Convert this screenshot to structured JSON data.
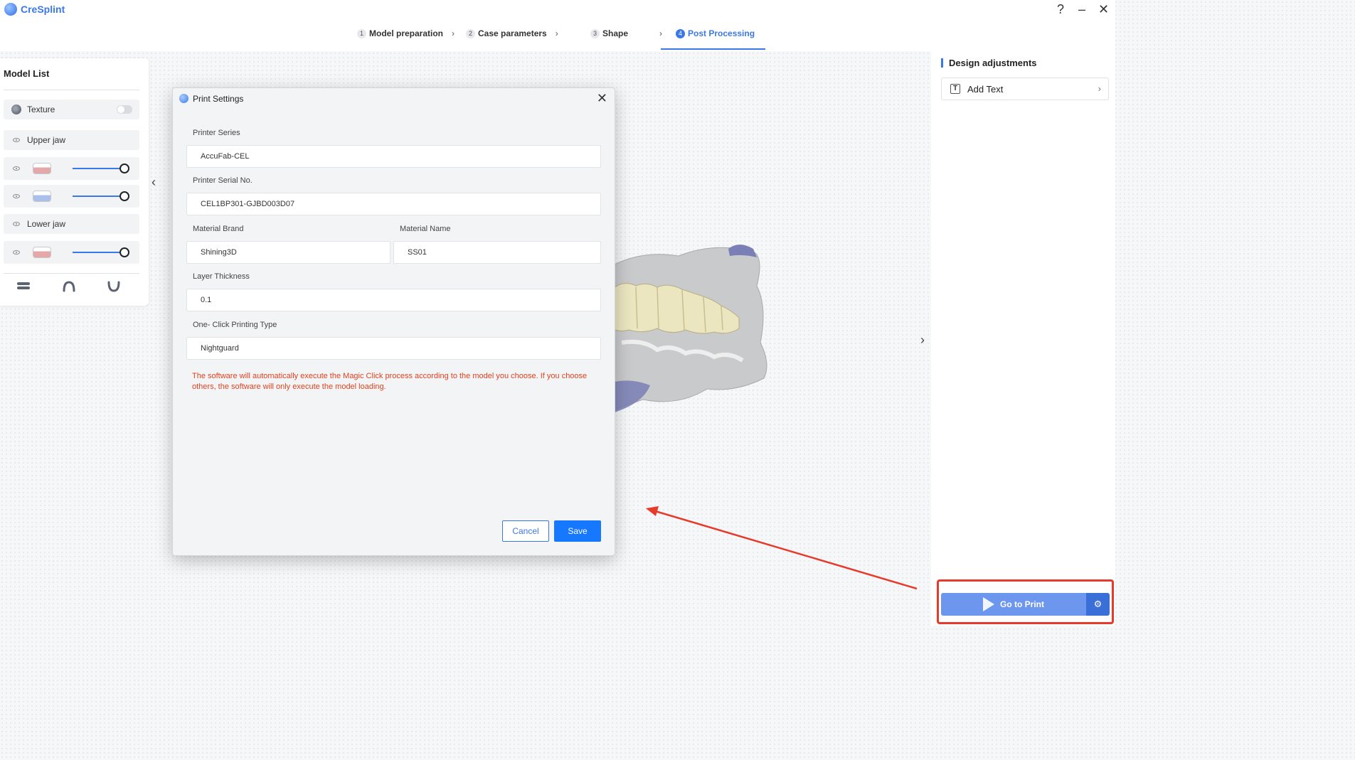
{
  "app": {
    "name": "CreSplint",
    "window_controls": {
      "help": "?",
      "minimize": "–",
      "close": "✕"
    }
  },
  "stepper": {
    "steps": [
      {
        "number": "1",
        "label": "Model preparation"
      },
      {
        "number": "2",
        "label": "Case parameters"
      },
      {
        "number": "3",
        "label": "Shape"
      },
      {
        "number": "4",
        "label": "Post Processing"
      }
    ],
    "active_step": "4"
  },
  "model_list": {
    "title": "Model List",
    "texture_label": "Texture",
    "texture_enabled": false,
    "upper_jaw_label": "Upper jaw",
    "lower_jaw_label": "Lower jaw",
    "upper_models": [
      {
        "icon": "upper-jaw-model-thumbnail",
        "opacity": 1.0
      },
      {
        "icon": "splint-model-thumbnail",
        "opacity": 1.0
      }
    ],
    "lower_models": [
      {
        "icon": "lower-jaw-model-thumbnail",
        "opacity": 1.0
      }
    ],
    "view_buttons": [
      "both-jaws-view-icon",
      "upper-jaw-view-icon",
      "lower-jaw-view-icon"
    ]
  },
  "design_panel": {
    "title": "Design adjustments",
    "add_text_label": "Add Text",
    "go_to_print_label": "Go to Print"
  },
  "print_dialog": {
    "title": "Print Settings",
    "printer_series_label": "Printer Series",
    "printer_series_value": "AccuFab-CEL",
    "printer_serial_label": "Printer Serial No.",
    "printer_serial_value": "CEL1BP301-GJBD003D07",
    "material_brand_label": "Material Brand",
    "material_brand_value": "Shining3D",
    "material_name_label": "Material Name",
    "material_name_value": "SS01",
    "layer_thickness_label": "Layer Thickness",
    "layer_thickness_value": "0.1",
    "printing_type_label": "One- Click Printing Type",
    "printing_type_value": "Nightguard",
    "warning": "The software will automatically execute the Magic Click process according to the model you choose. If you choose others, the software will only execute the model loading.",
    "cancel_label": "Cancel",
    "save_label": "Save"
  },
  "colors": {
    "accent": "#3b78e7",
    "save_button": "#1677ff",
    "warning_text": "#e0421f",
    "annotation_red": "#e63b2b",
    "go_to_print": "#6d97ee"
  }
}
